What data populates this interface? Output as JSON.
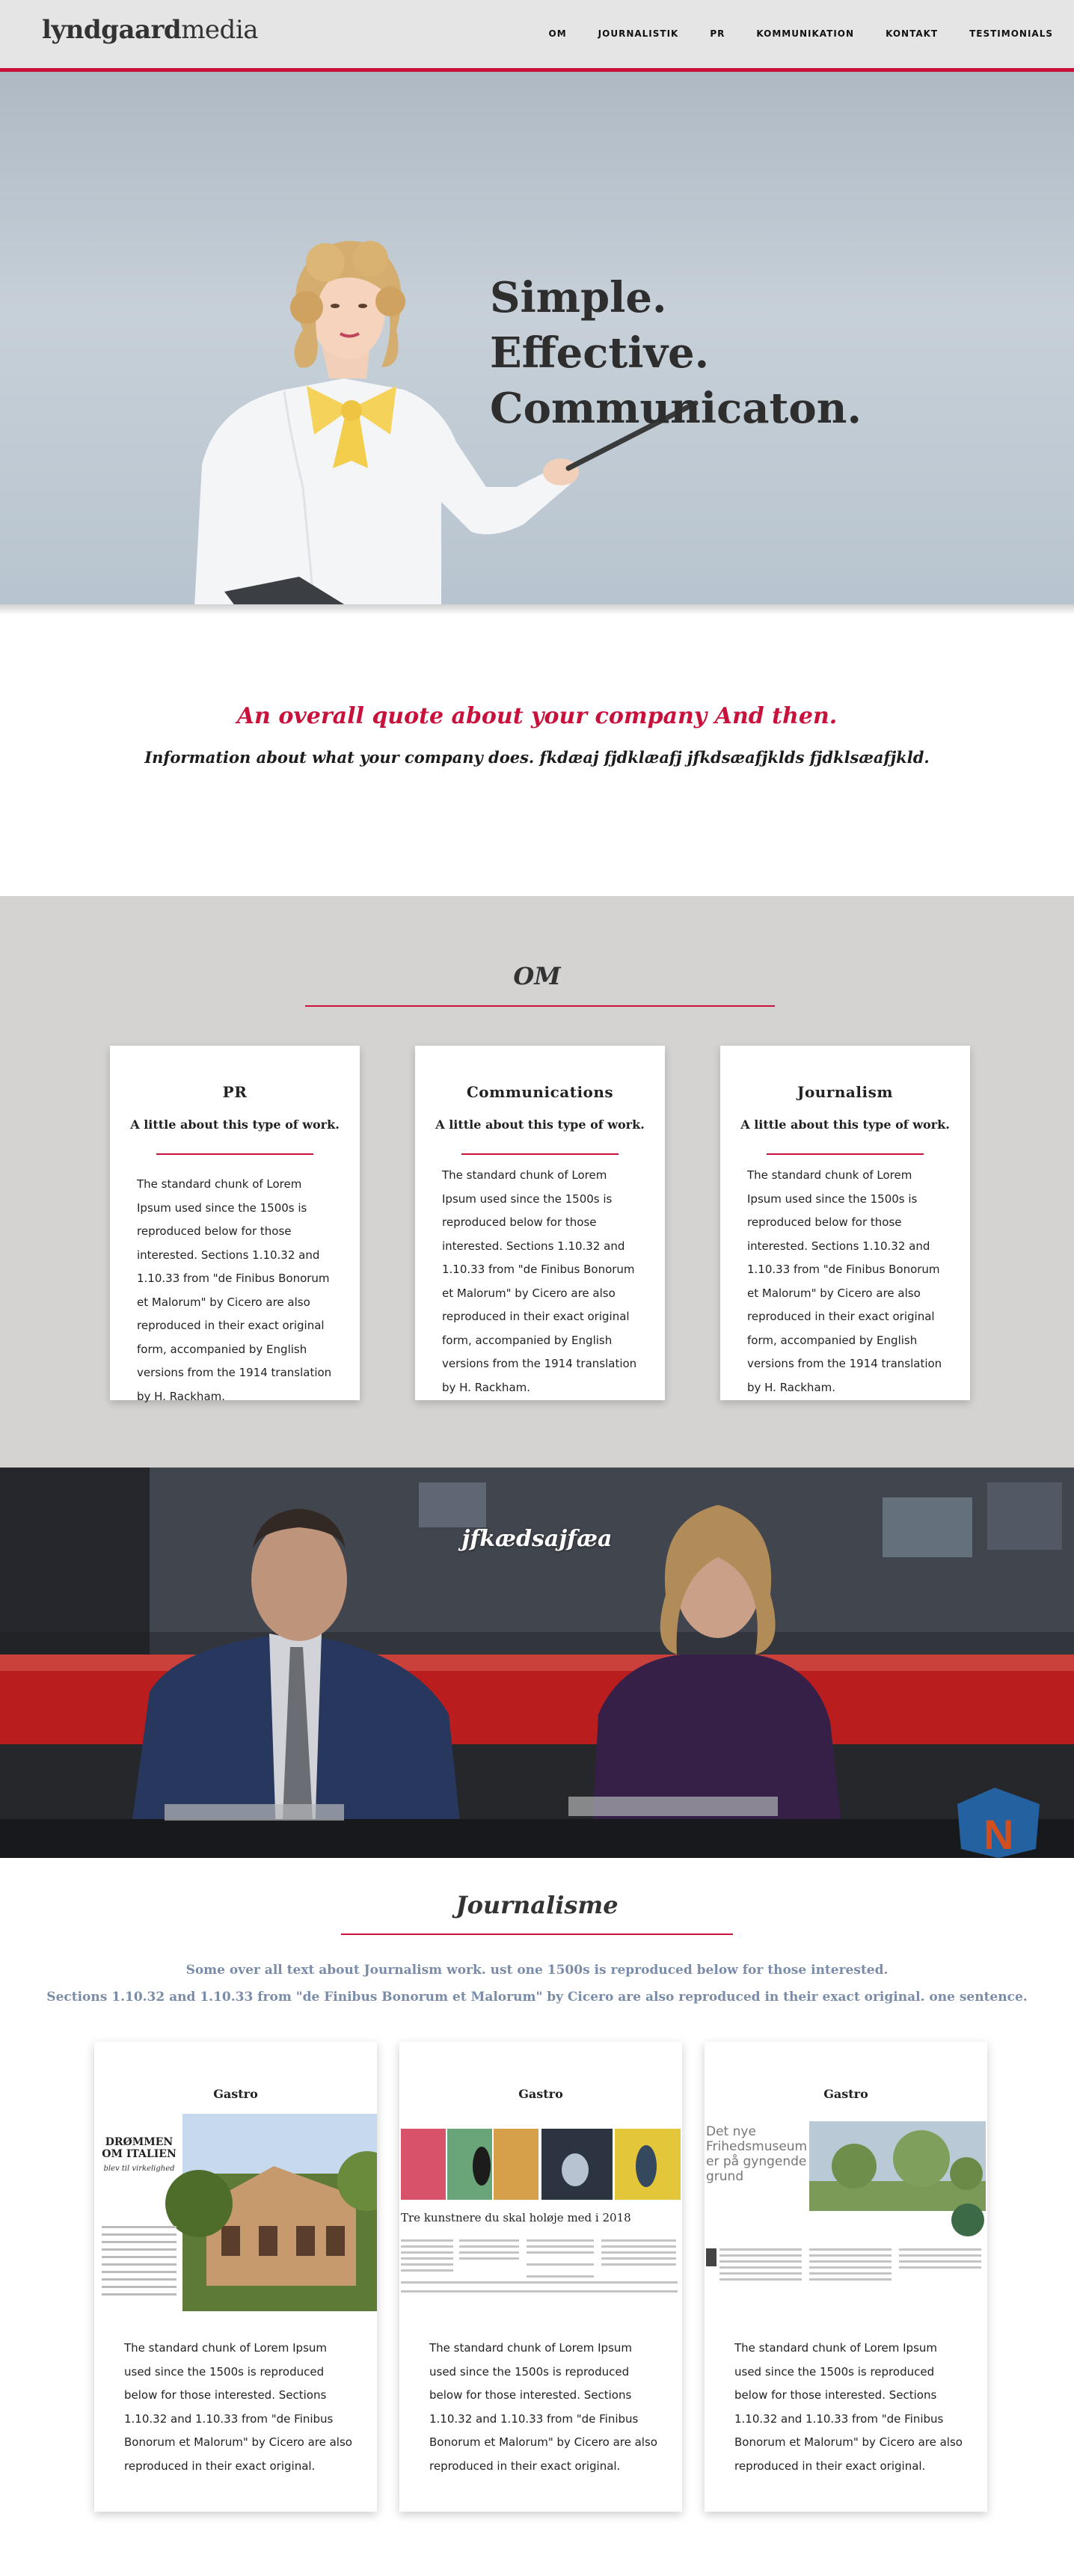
{
  "nav": {
    "logo_bold": "lyndgaard",
    "logo_light": "media",
    "links": [
      "OM",
      "JOURNALISTIK",
      "PR",
      "KOMMUNIKATION",
      "KONTAKT",
      "TESTIMONIALS"
    ]
  },
  "hero": {
    "lines": [
      "Simple.",
      "Effective.",
      "Communicaton."
    ]
  },
  "intro": {
    "quote": "An overall quote about your company And then.",
    "info": "Information about what your company does. fkdæaj fjdklæafj jfkdsæafjklds fjdklsæafjkld."
  },
  "om": {
    "heading": "OM",
    "cards": [
      {
        "title": "PR",
        "subtitle": "A little about this type of work.",
        "text": "The standard chunk of Lorem Ipsum used since the 1500s is reproduced below for those interested. Sections 1.10.32 and 1.10.33 from \"de Finibus Bonorum et Malorum\" by Cicero are also reproduced in their exact original form, accompanied by English versions from the 1914 translation by H. Rackham."
      },
      {
        "title": "Communications",
        "subtitle": "A little about this type of work.",
        "text": "The standard chunk of Lorem Ipsum used since the 1500s is reproduced below for those interested. Sections 1.10.32 and 1.10.33 from \"de Finibus Bonorum et Malorum\" by Cicero are also reproduced in their exact original form, accompanied by English versions from the 1914 translation by H. Rackham."
      },
      {
        "title": "Journalism",
        "subtitle": "A little about this type of work.",
        "text": "The standard chunk of Lorem Ipsum used since the 1500s is reproduced below for those interested. Sections 1.10.32 and 1.10.33 from \"de Finibus Bonorum et Malorum\" by Cicero are also reproduced in their exact original form, accompanied by English versions from the 1914 translation by H. Rackham."
      }
    ]
  },
  "banner": {
    "title": "jfkædsajfæa"
  },
  "journalisme": {
    "heading": "Journalisme",
    "intro_line1": "Some over all text about Journalism work. ust one 1500s is reproduced below for those interested.",
    "intro_line2": "Sections 1.10.32 and 1.10.33 from \"de Finibus Bonorum et Malorum\" by Cicero are also reproduced in their exact original. one sentence.",
    "cards": [
      {
        "title": "Gastro",
        "clip_headline": "DRØMMEN OM ITALIEN",
        "clip_sub": "blev til virkelighed",
        "text": "The standard chunk of Lorem Ipsum used since the 1500s is reproduced below for those interested. Sections 1.10.32 and 1.10.33 from \"de Finibus Bonorum et Malorum\" by Cicero are also reproduced in their exact original."
      },
      {
        "title": "Gastro",
        "clip_headline": "Tre kunstnere du skal holøje med i 2018",
        "text": "The standard chunk of Lorem Ipsum used since the 1500s is reproduced below for those interested. Sections 1.10.32 and 1.10.33 from \"de Finibus Bonorum et Malorum\" by Cicero are also reproduced in their exact original."
      },
      {
        "title": "Gastro",
        "clip_headline": "Det nye Frihedsmuseum er på gyngende grund",
        "text": "The standard chunk of Lorem Ipsum used since the 1500s is reproduced below for those interested. Sections 1.10.32 and 1.10.33 from \"de Finibus Bonorum et Malorum\" by Cicero are also reproduced in their exact original."
      }
    ]
  },
  "colors": {
    "accent": "#c8123c",
    "nav_bg": "#e6e5e5",
    "om_bg": "#d4d3d1",
    "intro_text": "#7a8ca8"
  }
}
